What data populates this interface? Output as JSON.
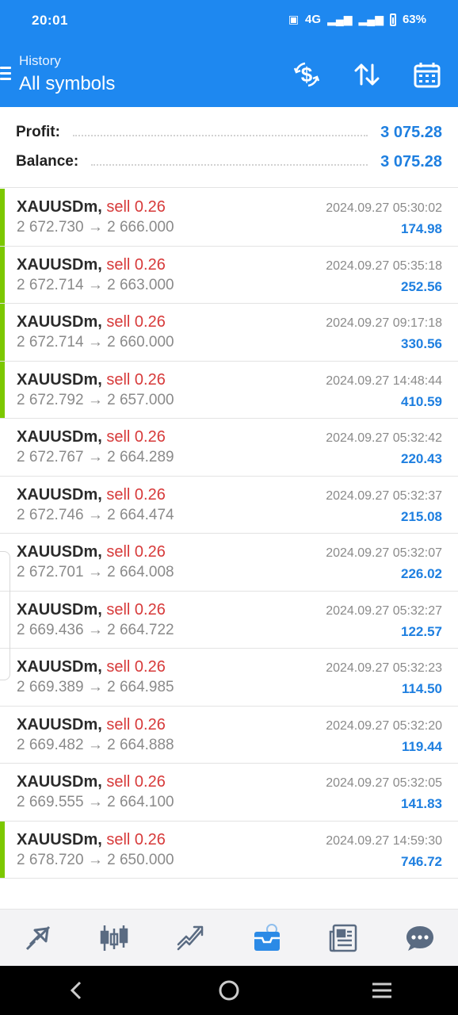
{
  "status_bar": {
    "time": "20:01",
    "network": "4G",
    "battery": "63%"
  },
  "header": {
    "subtitle": "History",
    "title": "All symbols",
    "icons": [
      "menu-icon",
      "deposit-icon",
      "sort-icon",
      "calendar-icon"
    ]
  },
  "summary": {
    "profit_label": "Profit:",
    "profit_value": "3 075.28",
    "balance_label": "Balance:",
    "balance_value": "3 075.28"
  },
  "trades": [
    {
      "symbol": "XAUUSDm,",
      "action": "sell 0.26",
      "open": "2 672.730",
      "close": "2 666.000",
      "datetime": "2024.09.27 05:30:02",
      "profit": "174.98",
      "marked": true
    },
    {
      "symbol": "XAUUSDm,",
      "action": "sell 0.26",
      "open": "2 672.714",
      "close": "2 663.000",
      "datetime": "2024.09.27 05:35:18",
      "profit": "252.56",
      "marked": true
    },
    {
      "symbol": "XAUUSDm,",
      "action": "sell 0.26",
      "open": "2 672.714",
      "close": "2 660.000",
      "datetime": "2024.09.27 09:17:18",
      "profit": "330.56",
      "marked": true
    },
    {
      "symbol": "XAUUSDm,",
      "action": "sell 0.26",
      "open": "2 672.792",
      "close": "2 657.000",
      "datetime": "2024.09.27 14:48:44",
      "profit": "410.59",
      "marked": true
    },
    {
      "symbol": "XAUUSDm,",
      "action": "sell 0.26",
      "open": "2 672.767",
      "close": "2 664.289",
      "datetime": "2024.09.27 05:32:42",
      "profit": "220.43",
      "marked": false
    },
    {
      "symbol": "XAUUSDm,",
      "action": "sell 0.26",
      "open": "2 672.746",
      "close": "2 664.474",
      "datetime": "2024.09.27 05:32:37",
      "profit": "215.08",
      "marked": false
    },
    {
      "symbol": "XAUUSDm,",
      "action": "sell 0.26",
      "open": "2 672.701",
      "close": "2 664.008",
      "datetime": "2024.09.27 05:32:07",
      "profit": "226.02",
      "marked": false
    },
    {
      "symbol": "XAUUSDm,",
      "action": "sell 0.26",
      "open": "2 669.436",
      "close": "2 664.722",
      "datetime": "2024.09.27 05:32:27",
      "profit": "122.57",
      "marked": false
    },
    {
      "symbol": "XAUUSDm,",
      "action": "sell 0.26",
      "open": "2 669.389",
      "close": "2 664.985",
      "datetime": "2024.09.27 05:32:23",
      "profit": "114.50",
      "marked": false
    },
    {
      "symbol": "XAUUSDm,",
      "action": "sell 0.26",
      "open": "2 669.482",
      "close": "2 664.888",
      "datetime": "2024.09.27 05:32:20",
      "profit": "119.44",
      "marked": false
    },
    {
      "symbol": "XAUUSDm,",
      "action": "sell 0.26",
      "open": "2 669.555",
      "close": "2 664.100",
      "datetime": "2024.09.27 05:32:05",
      "profit": "141.83",
      "marked": false
    },
    {
      "symbol": "XAUUSDm,",
      "action": "sell 0.26",
      "open": "2 678.720",
      "close": "2 650.000",
      "datetime": "2024.09.27 14:59:30",
      "profit": "746.72",
      "marked": true
    }
  ],
  "arrow": "→",
  "bottom_nav": [
    "quotes-icon",
    "chart-icon",
    "trade-icon",
    "history-icon",
    "news-icon",
    "chat-icon"
  ],
  "active_tab": "history-icon",
  "colors": {
    "accent": "#1e88f0",
    "profit": "#1e7fe0",
    "sell": "#d73a3a",
    "marker": "#7cc800"
  }
}
